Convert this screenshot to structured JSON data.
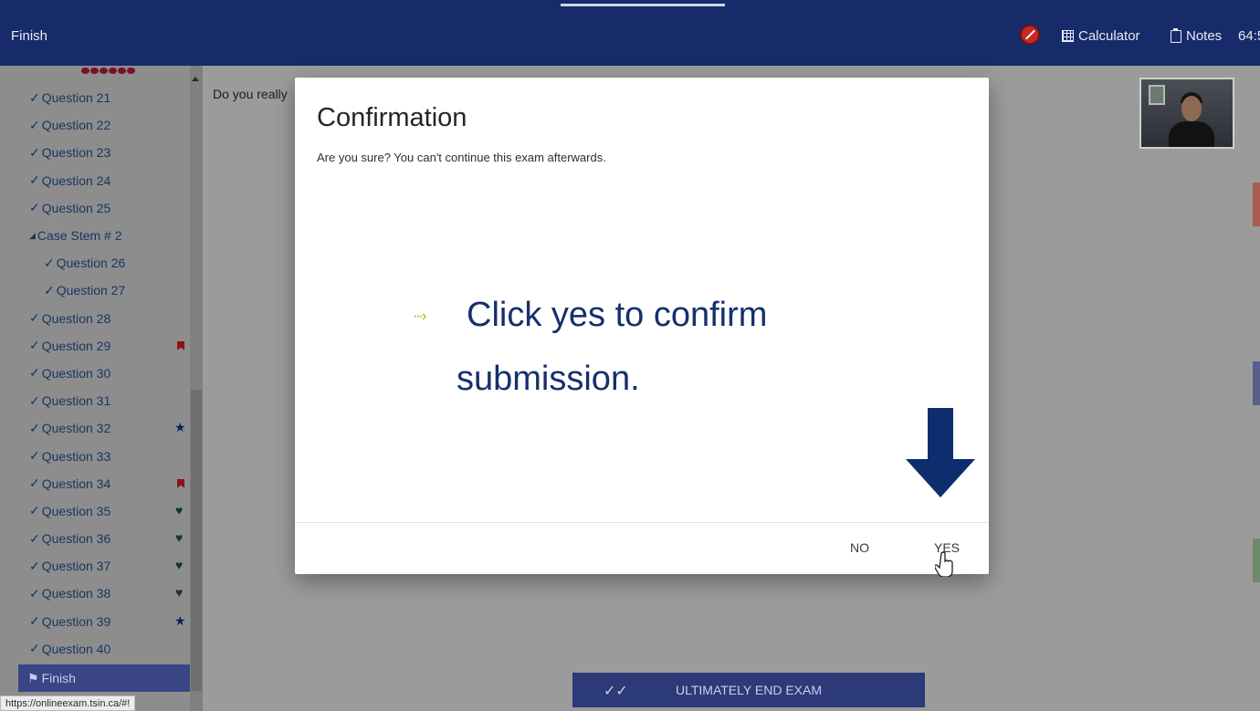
{
  "topbar": {
    "finish_label": "Finish",
    "calculator_label": "Calculator",
    "notes_label": "Notes",
    "timer": "64:5",
    "icons": [
      "no-pencil-icon",
      "calculator-icon",
      "clipboard-icon"
    ]
  },
  "sidebar": {
    "items": [
      {
        "label": "Question 21",
        "mark": ""
      },
      {
        "label": "Question 22",
        "mark": ""
      },
      {
        "label": "Question 23",
        "mark": ""
      },
      {
        "label": "Question 24",
        "mark": ""
      },
      {
        "label": "Question 25",
        "mark": ""
      },
      {
        "label": "Case Stem # 2",
        "mark": ""
      },
      {
        "label": "Question 26",
        "mark": ""
      },
      {
        "label": "Question 27",
        "mark": ""
      },
      {
        "label": "Question 28",
        "mark": ""
      },
      {
        "label": "Question 29",
        "mark": "flag"
      },
      {
        "label": "Question 30",
        "mark": ""
      },
      {
        "label": "Question 31",
        "mark": ""
      },
      {
        "label": "Question 32",
        "mark": "star"
      },
      {
        "label": "Question 33",
        "mark": ""
      },
      {
        "label": "Question 34",
        "mark": "flag"
      },
      {
        "label": "Question 35",
        "mark": "heart"
      },
      {
        "label": "Question 36",
        "mark": "heart"
      },
      {
        "label": "Question 37",
        "mark": "heart"
      },
      {
        "label": "Question 38",
        "mark": "heart"
      },
      {
        "label": "Question 39",
        "mark": "star"
      },
      {
        "label": "Question 40",
        "mark": ""
      }
    ],
    "finish_label": "Finish",
    "status_url": "https://onlineexam.tsin.ca/#!"
  },
  "main": {
    "prompt_text": "Do you really",
    "end_exam_label": "ULTIMATELY END EXAM"
  },
  "modal": {
    "title": "Confirmation",
    "message": "Are you sure? You can't continue this exam afterwards.",
    "no_label": "NO",
    "yes_label": "YES"
  },
  "annotation": {
    "arrow_glyph": "···›",
    "line1": "Click yes to confirm",
    "line2": "submission."
  },
  "colors": {
    "topbar": "#172a69",
    "annotation_text": "#14306d",
    "down_arrow": "#0e2d6e",
    "pointer_arrow": "#a8b400"
  }
}
